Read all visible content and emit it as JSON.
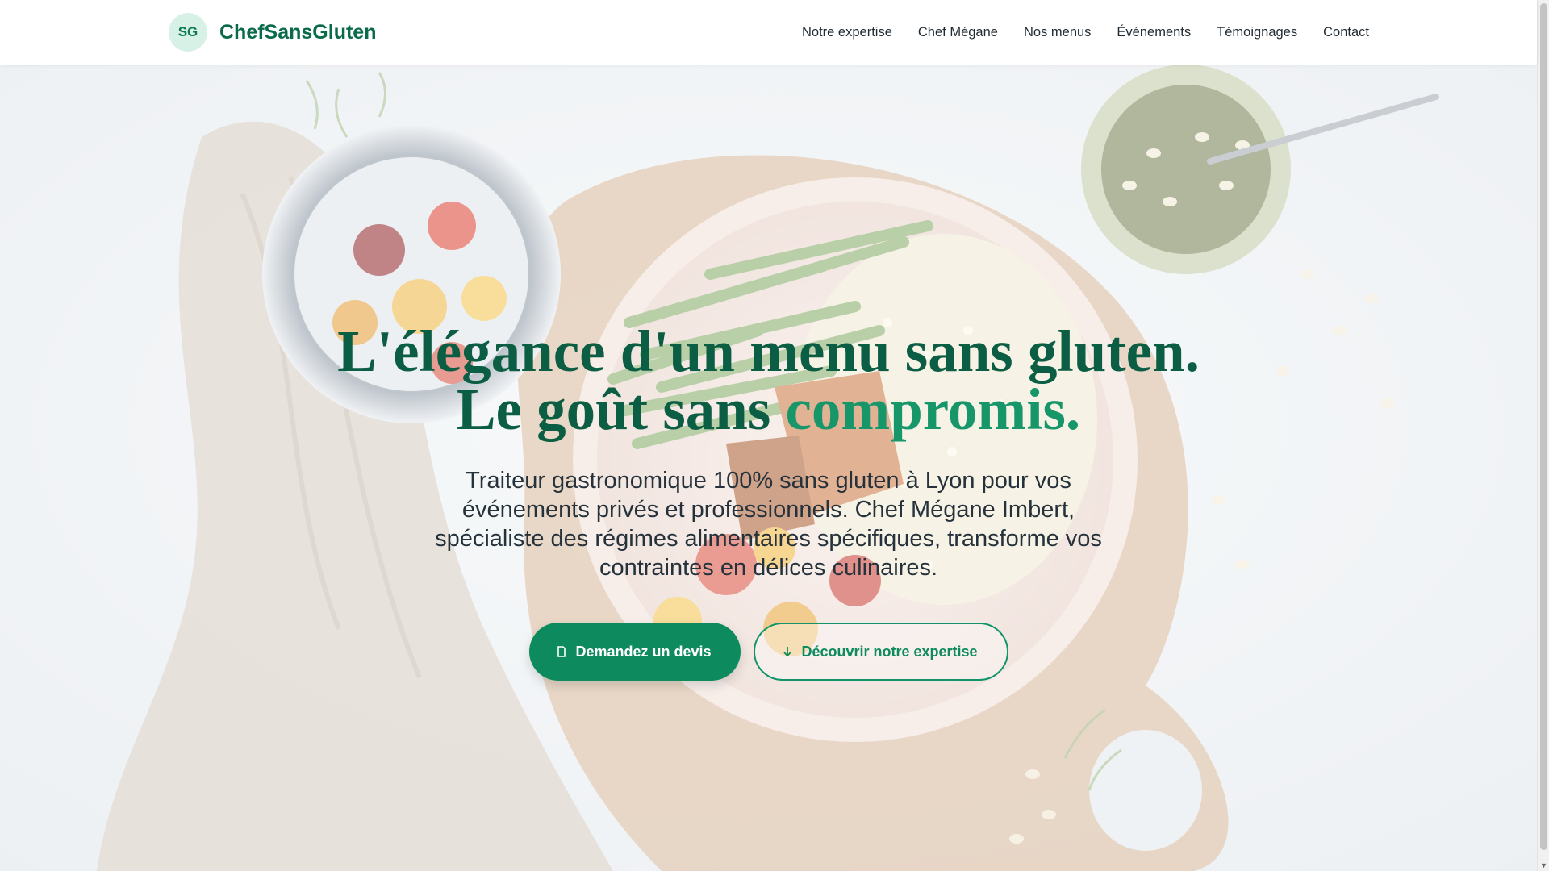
{
  "brand": {
    "badge": "SG",
    "name": "ChefSansGluten"
  },
  "nav": {
    "items": [
      "Notre expertise",
      "Chef Mégane",
      "Nos menus",
      "Événements",
      "Témoignages",
      "Contact"
    ]
  },
  "hero": {
    "title_line1": "L'élégance d'un menu sans gluten.",
    "title_line2_start": "Le goût sans ",
    "title_line2_accent": "compromis.",
    "subtitle": "Traiteur gastronomique 100% sans gluten à Lyon pour vos événements privés et professionnels. Chef Mégane Imbert, spécialiste des régimes alimentaires spécifiques, transforme vos contraintes en délices culinaires.",
    "cta_primary": "Demandez un devis",
    "cta_secondary": "Découvrir notre expertise"
  },
  "colors": {
    "brand_green": "#0d8a5e",
    "title_green": "#0b5e43",
    "accent_green": "#17966a"
  },
  "icons": {
    "cta_primary_icon": "document-icon",
    "cta_secondary_icon": "arrow-down-icon"
  }
}
